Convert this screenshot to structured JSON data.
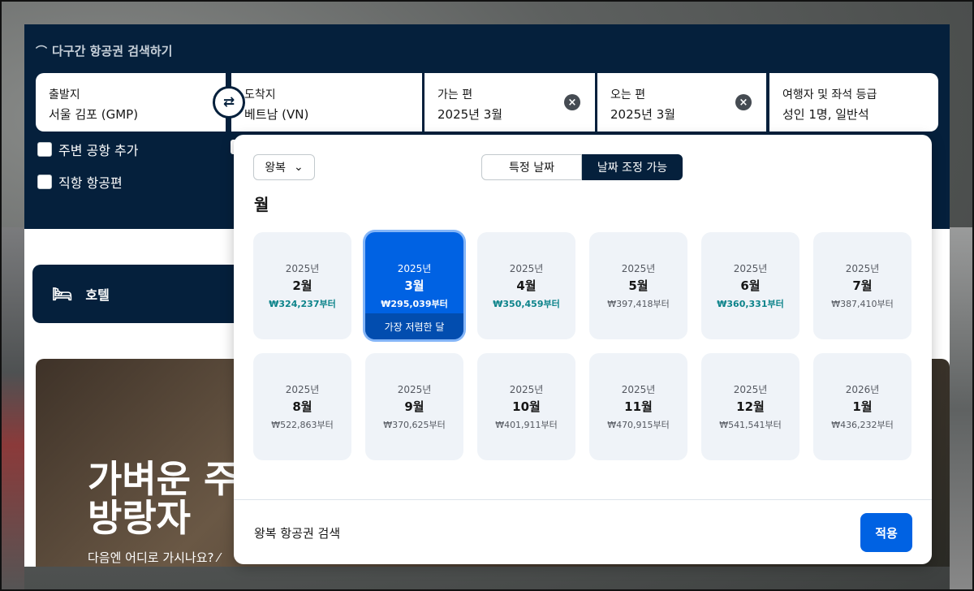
{
  "search": {
    "multi_city_label": "다구간 항공권 검색하기",
    "origin": {
      "label": "출발지",
      "value": "서울 김포 (GMP)"
    },
    "destination": {
      "label": "도착지",
      "value": "베트남 (VN)"
    },
    "depart": {
      "label": "가는 편",
      "value": "2025년 3월"
    },
    "return": {
      "label": "오는 편",
      "value": "2025년 3월"
    },
    "travelers": {
      "label": "여행자 및 좌석 등급",
      "value": "성인 1명, 일반석"
    },
    "nearby_airports_label": "주변 공항 추가",
    "direct_flights_label": "직항 항공편"
  },
  "tabs": {
    "hotel_label": "호텔"
  },
  "hero": {
    "title_line1": "가벼운 주",
    "title_line2": "방랑자",
    "subtitle": "다음엔 어디로 가시나요? ⁄"
  },
  "popover": {
    "trip_type": "왕복",
    "toggle_specific": "특정 날짜",
    "toggle_flexible": "날짜 조정 가능",
    "heading": "월",
    "cheapest_label": "가장 저렴한 달",
    "footer_text": "왕복 항공권 검색",
    "apply_label": "적용",
    "months": [
      {
        "year": "2025년",
        "month": "2월",
        "price": "₩324,237부터",
        "cheap": true,
        "selected": false
      },
      {
        "year": "2025년",
        "month": "3월",
        "price": "₩295,039부터",
        "cheap": true,
        "selected": true
      },
      {
        "year": "2025년",
        "month": "4월",
        "price": "₩350,459부터",
        "cheap": true,
        "selected": false
      },
      {
        "year": "2025년",
        "month": "5월",
        "price": "₩397,418부터",
        "cheap": false,
        "selected": false
      },
      {
        "year": "2025년",
        "month": "6월",
        "price": "₩360,331부터",
        "cheap": true,
        "selected": false
      },
      {
        "year": "2025년",
        "month": "7월",
        "price": "₩387,410부터",
        "cheap": false,
        "selected": false
      },
      {
        "year": "2025년",
        "month": "8월",
        "price": "₩522,863부터",
        "cheap": false,
        "selected": false
      },
      {
        "year": "2025년",
        "month": "9월",
        "price": "₩370,625부터",
        "cheap": false,
        "selected": false
      },
      {
        "year": "2025년",
        "month": "10월",
        "price": "₩401,911부터",
        "cheap": false,
        "selected": false
      },
      {
        "year": "2025년",
        "month": "11월",
        "price": "₩470,915부터",
        "cheap": false,
        "selected": false
      },
      {
        "year": "2025년",
        "month": "12월",
        "price": "₩541,541부터",
        "cheap": false,
        "selected": false
      },
      {
        "year": "2026년",
        "month": "1월",
        "price": "₩436,232부터",
        "cheap": false,
        "selected": false
      }
    ]
  },
  "colors": {
    "navy": "#05203c",
    "primary_blue": "#0062e3",
    "cheap_price": "#0c838a"
  }
}
